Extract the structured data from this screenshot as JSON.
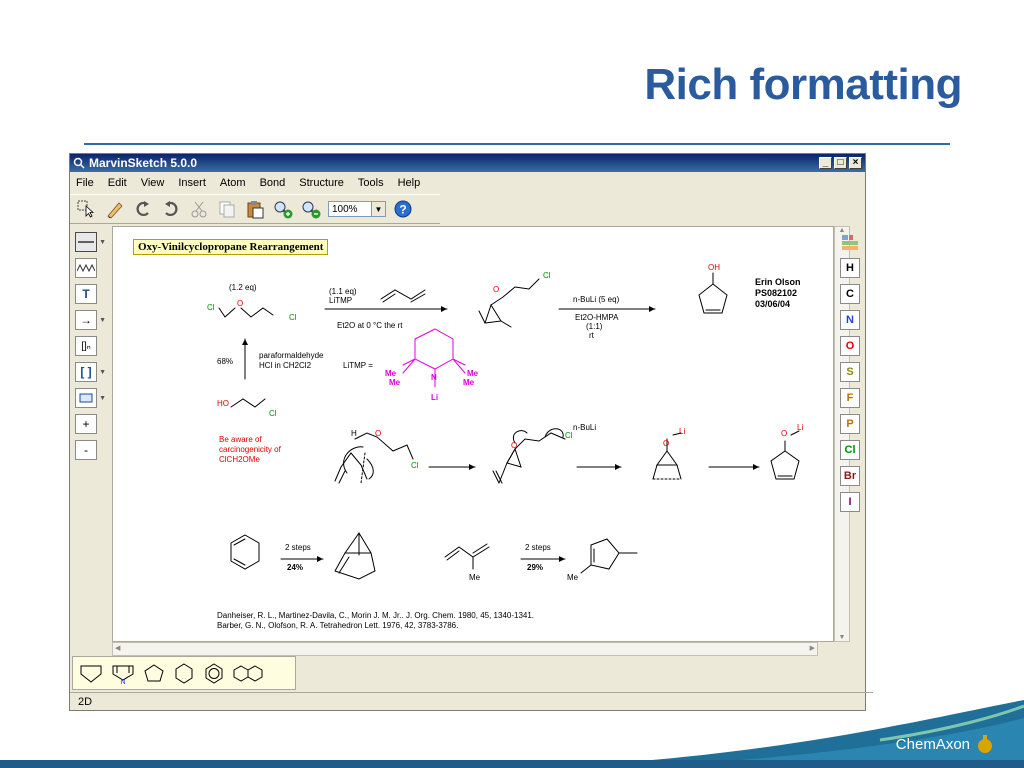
{
  "slide": {
    "title": "Rich formatting",
    "brand": "ChemAxon"
  },
  "window": {
    "title": "MarvinSketch 5.0.0",
    "min_label": "_",
    "max_label": "□",
    "close_label": "×"
  },
  "menu": [
    "File",
    "Edit",
    "View",
    "Insert",
    "Atom",
    "Bond",
    "Structure",
    "Tools",
    "Help"
  ],
  "toolbar": {
    "zoom_value": "100%",
    "icons": [
      "select-arrow-icon",
      "eraser-icon",
      "undo-icon",
      "redo-icon",
      "cut-icon",
      "copy-icon",
      "paste-icon",
      "zoom-in-icon",
      "zoom-out-icon",
      "help-icon"
    ]
  },
  "left_tools": [
    {
      "name": "single-bond-tool",
      "label": "—"
    },
    {
      "name": "chain-tool",
      "label": "⌇"
    },
    {
      "name": "text-tool",
      "label": "T"
    },
    {
      "name": "arrow-tool",
      "label": "→"
    },
    {
      "name": "repeat-group-tool",
      "label": "[]n"
    },
    {
      "name": "bracket-tool",
      "label": "[ ]"
    },
    {
      "name": "rectangle-tool",
      "label": "▭"
    },
    {
      "name": "increase-charge-tool",
      "label": "+"
    },
    {
      "name": "decrease-charge-tool",
      "label": "-"
    }
  ],
  "right_tools": [
    {
      "label": "H",
      "color": "#000000"
    },
    {
      "label": "C",
      "color": "#000000"
    },
    {
      "label": "N",
      "color": "#2040e0"
    },
    {
      "label": "O",
      "color": "#e00000"
    },
    {
      "label": "S",
      "color": "#8a8a00"
    },
    {
      "label": "F",
      "color": "#c07000"
    },
    {
      "label": "P",
      "color": "#c07000"
    },
    {
      "label": "Cl",
      "color": "#009000"
    },
    {
      "label": "Br",
      "color": "#8b1a1a"
    },
    {
      "label": "I",
      "color": "#800080"
    }
  ],
  "status": {
    "mode": "2D"
  },
  "canvas": {
    "heading": "Oxy-Vinilcyclopropane Rearrangement",
    "author": {
      "name": "Erin Olson",
      "code": "PS082102",
      "date": "03/06/04"
    },
    "texts": {
      "eq12": "(1.2 eq)",
      "eq11": "(1.1 eq)",
      "litmp": "LiTMP",
      "et2o": "Et2O at 0 °C the rt",
      "nbuli5": "n-BuLi (5 eq)",
      "et2ohmpa": "Et2O-HMPA",
      "ratio": "(1:1)",
      "rt": "rt",
      "yield68": "68%",
      "paraform": "paraformaldehyde",
      "hcl": "HCl in CH2Cl2",
      "litmp_eq": "LiTMP =",
      "warning1": "Be aware of",
      "warning2": "carcinogenicity of",
      "warning3": "ClCH2OMe",
      "nbuli": "n-BuLi",
      "steps2a": "2 steps",
      "y24": "24%",
      "steps2b": "2 steps",
      "y29": "29%",
      "ref1": "Danheiser, R. L., Martinez-Davila, C., Morin J. M. Jr.. J. Org. Chem. 1980, 45, 1340-1341.",
      "ref2": "Barber, G. N., Olofson, R. A. Tetrahedron Lett. 1976, 42, 3783-3786."
    }
  },
  "templates": [
    "cyclopentane-chair-icon",
    "pyrrole-template-icon",
    "cyclopentane-icon",
    "cyclohexane-icon",
    "benzene-icon",
    "naphthalene-icon"
  ]
}
